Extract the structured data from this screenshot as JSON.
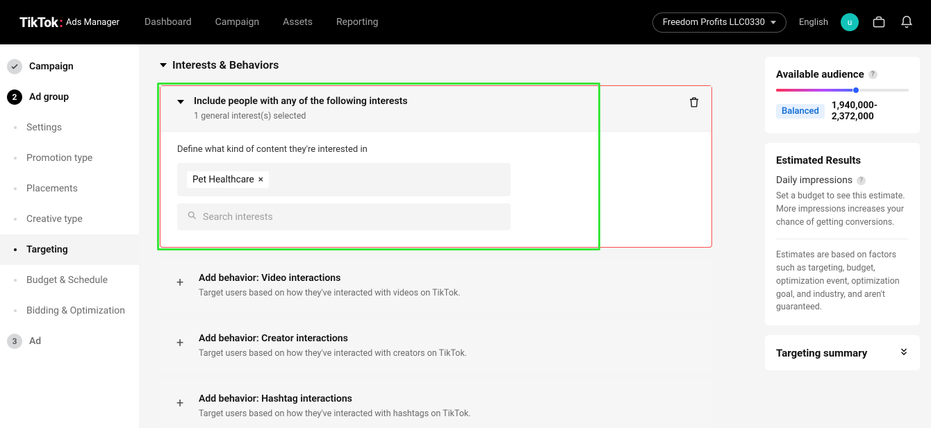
{
  "header": {
    "logo_main": "TikTok",
    "logo_sub": "Ads Manager",
    "nav": [
      "Dashboard",
      "Campaign",
      "Assets",
      "Reporting"
    ],
    "account_name": "Freedom Profits LLC0330",
    "language": "English",
    "avatar_initial": "u"
  },
  "sidebar": {
    "campaign": "Campaign",
    "adgroup": "Ad group",
    "adgroup_number": "2",
    "subitems": [
      "Settings",
      "Promotion type",
      "Placements",
      "Creative type",
      "Targeting",
      "Budget & Schedule",
      "Bidding & Optimization"
    ],
    "active_sub_index": 4,
    "ad": "Ad",
    "ad_number": "3"
  },
  "main": {
    "section_title": "Interests & Behaviors",
    "interest_box": {
      "title": "Include people with any of the following interests",
      "subtitle": "1 general interest(s) selected",
      "define_label": "Define what kind of content they're interested in",
      "chips": [
        "Pet Healthcare"
      ],
      "search_placeholder": "Search interests"
    },
    "behaviors": [
      {
        "title": "Add behavior: Video interactions",
        "sub": "Target users based on how they've interacted with videos on TikTok."
      },
      {
        "title": "Add behavior: Creator interactions",
        "sub": "Target users based on how they've interacted with creators on TikTok."
      },
      {
        "title": "Add behavior: Hashtag interactions",
        "sub": "Target users based on how they've interacted with hashtags on TikTok."
      }
    ]
  },
  "right": {
    "available_audience_title": "Available audience",
    "balanced_label": "Balanced",
    "audience_range": "1,940,000-2,372,000",
    "estimated_results_title": "Estimated Results",
    "daily_impressions_label": "Daily impressions",
    "daily_impressions_text": "Set a budget to see this estimate. More impressions increases your chance of getting conversions.",
    "disclaimer": "Estimates are based on factors such as targeting, budget, optimization event, optimization goal, and industry, and aren't guaranteed.",
    "targeting_summary_title": "Targeting summary"
  }
}
